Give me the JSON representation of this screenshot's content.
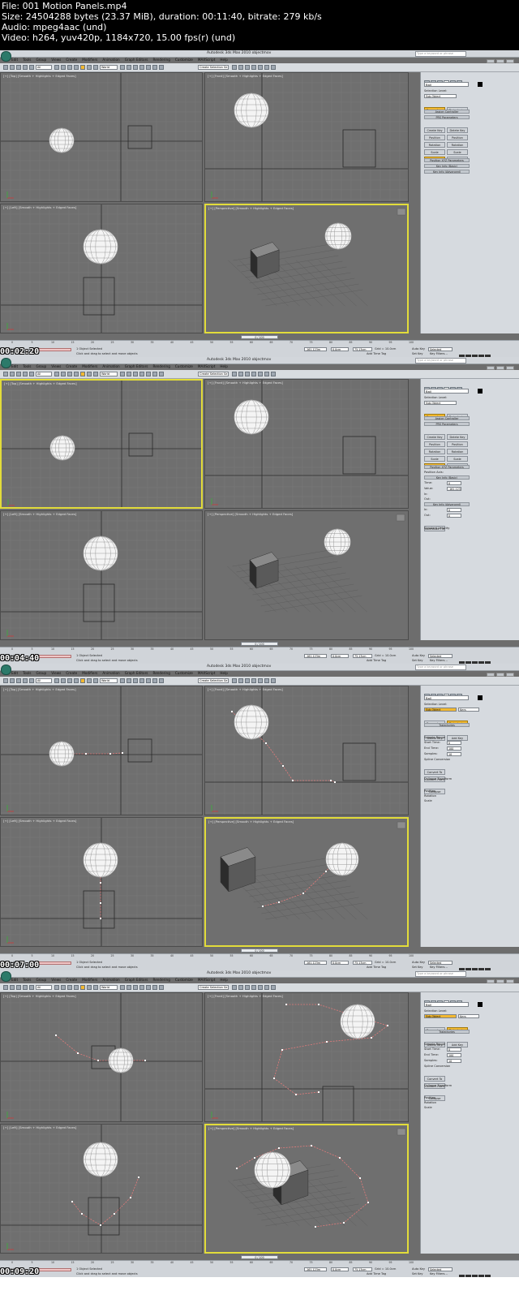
{
  "header": {
    "lines": [
      "File: 001 Motion Panels.mp4",
      "Size: 24504288 bytes (23.37 MiB), duration: 00:11:40, bitrate: 279 kb/s",
      "Audio: mpeg4aac (und)",
      "Video: h264, yuv420p, 1184x720, 15.00 fps(r) (und)"
    ]
  },
  "app": {
    "title": "Autodesk 3ds Max  2010     objectmov",
    "help_placeholder": "Type a keyword or phrase",
    "menus": [
      "Edit",
      "Tools",
      "Group",
      "Views",
      "Create",
      "Modifiers",
      "Animation",
      "Graph Editors",
      "Rendering",
      "Customize",
      "MAXScript",
      "Help"
    ],
    "selection_filter": "All",
    "ref_coord": "World",
    "named_selection": "Create Selection Se"
  },
  "viewports": {
    "top": "[+] [Top] [Smooth + Highlights + Edged Faces]",
    "front": "[+] [Front] [Smooth + Highlights + Edged Faces]",
    "left": "[+] [Left] [Smooth + Highlights + Edged Faces]",
    "perspective": "[+] [Perspective] [Smooth + Highlights + Edged Faces]"
  },
  "status": {
    "object_selected": "1 Object Selected",
    "prompt": "Click and drag to select and move objects",
    "maxscript": "MAXScript Mi",
    "x_value": "-161.123m",
    "y_value": "0.0cm",
    "z_value": "75.13cm",
    "grid": "Grid = 10.0cm",
    "auto_key": "Auto Key",
    "set_key": "Set Key",
    "selected": "Selected",
    "key_filters": "Key Filters...",
    "add_time_tag": "Add Time Tag",
    "ruler_ticks": [
      "0",
      "5",
      "10",
      "15",
      "20",
      "25",
      "30",
      "35",
      "40",
      "45",
      "50",
      "55",
      "60",
      "65",
      "70",
      "75",
      "80",
      "85",
      "90",
      "95",
      "100"
    ]
  },
  "panel": {
    "object_name": "Ball",
    "selection_level": "Selection Level:",
    "sub_object": "Sub-Object",
    "keys": "Keys",
    "parameters_tab": "Parameters",
    "trajectories_tab": "Trajectories",
    "assign_controller": "Assign Controller",
    "prs_parameters": "PRS Parameters",
    "create_key": "Create Key",
    "delete_key": "Delete Key",
    "position": "Position",
    "rotation": "Rotation",
    "scale": "Scale",
    "position_xyz": "Position XYZ Parameters",
    "key_info_basic": "Key Info (Basic)",
    "key_info_advanced": "Key Info (Advanced)",
    "position_axis": "Position Axis:",
    "trajectories": "Trajectories",
    "delete_key_t": "Delete Key",
    "add_key": "Add Key",
    "sample_range": "Sample Range",
    "start_time": "Start Time:",
    "end_time": "End Time:",
    "samples": "Samples:",
    "start_time_val": "0",
    "end_time_val": "100",
    "samples_val": "10",
    "spline_conversion": "Spline Conversion",
    "convert_to": "Convert To",
    "convert_from": "Convert From",
    "collapse_transform": "Collapse Transform",
    "collapse": "Collapse",
    "pos_check": "Position",
    "rot_check": "Rotation",
    "scale_check": "Scale",
    "time_label": "Time:",
    "value_label": "Value:",
    "in_label": "In:",
    "out_label": "Out:",
    "normalize_time": "Normalize Time",
    "constant_velocity": "Constant Velocity",
    "time_val": "0",
    "value_val": "-161.123"
  },
  "frames": [
    {
      "timestamp": "00:02:20",
      "frame_label": "0 / 100",
      "panel_mode": "params"
    },
    {
      "timestamp": "00:04:40",
      "frame_label": "0 / 100",
      "panel_mode": "keyinfo"
    },
    {
      "timestamp": "00:07:00",
      "frame_label": "0 / 100",
      "panel_mode": "trajectories"
    },
    {
      "timestamp": "00:09:20",
      "frame_label": "0 / 100",
      "panel_mode": "trajectories"
    }
  ]
}
